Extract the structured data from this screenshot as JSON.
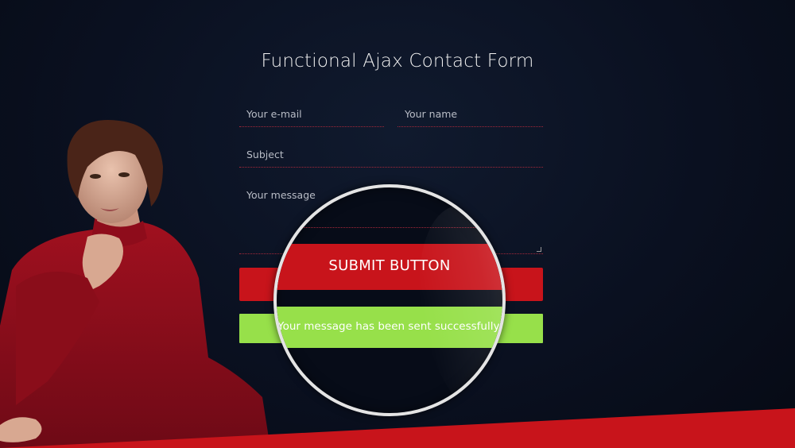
{
  "page": {
    "title": "Functional Ajax Contact Form"
  },
  "form": {
    "email_placeholder": "Your e-mail",
    "name_placeholder": "Your name",
    "subject_placeholder": "Subject",
    "message_placeholder": "Your message",
    "submit_label": "SUBMIT BUTTON",
    "success_message": "Your message has been sent successfully."
  },
  "colors": {
    "background": "#0a1020",
    "accent_red": "#c8141b",
    "success_green": "#97e04a",
    "field_underline": "#a4283a"
  },
  "icons": {
    "resize_handle": "resize-handle-icon"
  }
}
